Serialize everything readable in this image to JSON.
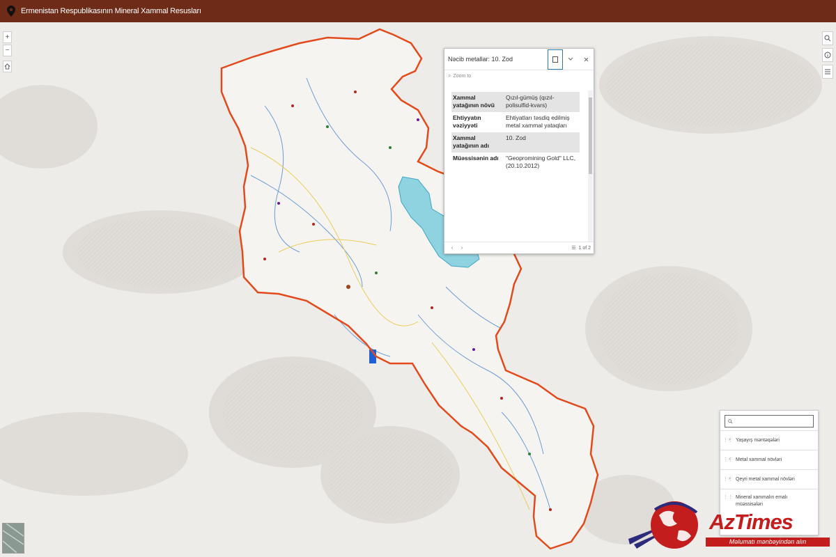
{
  "header": {
    "title": "Ermenistan Respublikasının Mineral Xammal Resusları",
    "pin_icon": "location-pin-icon"
  },
  "colors": {
    "header_bg": "#6e2b18",
    "border_red": "#e24a1c",
    "lake": "#8fd3e0",
    "accent": "#2a7ab0",
    "logo_red": "#c31d1d"
  },
  "map_controls": {
    "zoom_in": "+",
    "zoom_out": "−",
    "home_icon": "home-icon",
    "right_icons": [
      "search-icon",
      "info-icon",
      "layers-icon"
    ]
  },
  "popup": {
    "title": "Nəcib metallar: 10. Zod",
    "zoom_to": "Zoom to",
    "attributes": [
      {
        "key": "Xammal yatağının növü",
        "value": "Qızıl-gümüş (qızıl-polisulfid-kvars)"
      },
      {
        "key": "Ehtiyyatın vəziyyəti",
        "value": "Ehtiyatları təsdiq edilmiş metal xammal yataqları"
      },
      {
        "key": "Xammal yatağının adı",
        "value": "10. Zod"
      },
      {
        "key": "Müəssisənin adı",
        "value": "\"Geopromining Gold\" LLC, (20.10.2012)"
      }
    ],
    "pager": "1 of 2"
  },
  "layers": {
    "items": [
      {
        "label": "Yaşayış məntəqələri"
      },
      {
        "label": "Metal xammal növləri"
      },
      {
        "label": "Qeyri metal xammal növləri"
      },
      {
        "label": "Mineral xammalın emalı müəssisələri"
      }
    ]
  },
  "logo": {
    "brand": "AzTimes",
    "tagline": "Məlumatı mənbəyindən alın"
  }
}
